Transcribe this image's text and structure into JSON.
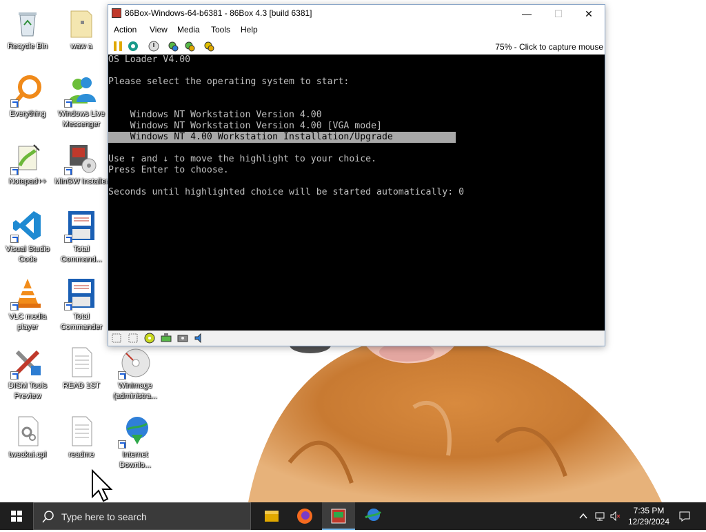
{
  "desktop": {
    "icons": [
      {
        "label": "Recycle Bin",
        "icon": "recycle-bin-icon"
      },
      {
        "label": "waw a",
        "icon": "folder-icon"
      },
      {
        "label": "Everything",
        "icon": "everything-search-icon"
      },
      {
        "label": "Windows Live Messenger",
        "icon": "messenger-icon"
      },
      {
        "label": "Notepad++",
        "icon": "notepadpp-icon"
      },
      {
        "label": "MinGW Installer",
        "icon": "mingw-installer-icon"
      },
      {
        "label": "Visual Studio Code",
        "icon": "vscode-icon"
      },
      {
        "label": "Total Command...",
        "icon": "total-commander-64-icon"
      },
      {
        "label": "VLC media player",
        "icon": "vlc-icon"
      },
      {
        "label": "Total Commander",
        "icon": "total-commander-icon"
      },
      {
        "label": "DISM Tools Preview",
        "icon": "dism-tools-icon"
      },
      {
        "label": "READ 1ST",
        "icon": "text-file-icon"
      },
      {
        "label": "WinImage (administra...",
        "icon": "winimage-icon"
      },
      {
        "label": "tweakui.cpl",
        "icon": "cpl-file-icon"
      },
      {
        "label": "readme",
        "icon": "text-file-icon"
      },
      {
        "label": "Internet Downlo...",
        "icon": "internet-download-manager-icon"
      }
    ]
  },
  "window": {
    "title": "86Box-Windows-64-b6381 - 86Box 4.3 [build 6381]",
    "controls": {
      "minimize": "—",
      "maximize": "☐",
      "close": "✕"
    },
    "menu": [
      "Action",
      "View",
      "Media",
      "Tools",
      "Help"
    ],
    "capture_status": "75% - Click to capture mouse",
    "screen_lines": [
      "OS Loader V4.00",
      "",
      "Please select the operating system to start:",
      "",
      "",
      "    Windows NT Workstation Version 4.00",
      "    Windows NT Workstation Version 4.00 [VGA mode]",
      "    Windows NT 4.00 Workstation Installation/Upgrade",
      "",
      "Use ↑ and ↓ to move the highlight to your choice.",
      "Press Enter to choose.",
      "",
      "Seconds until highlighted choice will be started automatically: 0"
    ],
    "highlighted_line": 7
  },
  "taskbar": {
    "search_placeholder": "Type here to search",
    "time": "7:35 PM",
    "date": "12/29/2024",
    "apps": [
      "file-explorer-icon",
      "firefox-icon",
      "86box-icon",
      "internet-download-manager-icon"
    ]
  }
}
